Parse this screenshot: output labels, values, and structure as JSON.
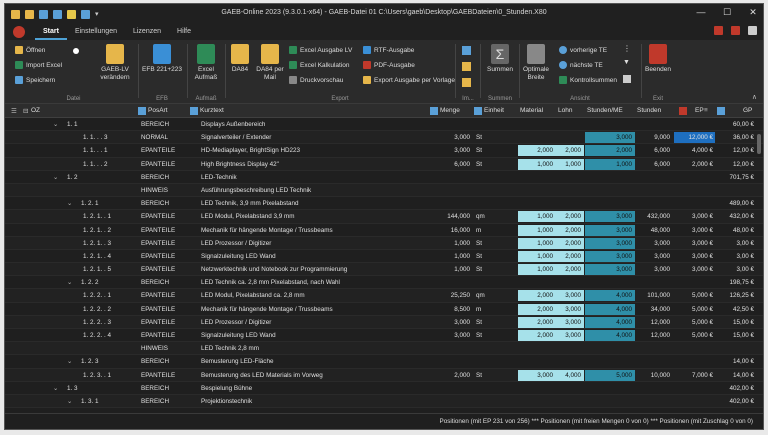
{
  "window": {
    "title": "GAEB-Online 2023 (9.3.0.1-x64) - GAEB-Datei  01 C:\\Users\\gaeb\\Desktop\\GAEBDateien\\0_Stunden.X80"
  },
  "tabs": [
    "Start",
    "Einstellungen",
    "Lizenzen",
    "Hilfe"
  ],
  "ribbon": {
    "datei": {
      "label": "Datei",
      "items": [
        "Öffnen",
        "Import Excel",
        "Speichern"
      ],
      "big": "GAEB-LV verändern"
    },
    "efb": {
      "label": "EFB",
      "big": "EFB 221+223"
    },
    "aufmass": {
      "label": "Aufmaß",
      "big": "Excel Aufmaß"
    },
    "export": {
      "label": "Export",
      "da84": "DA84",
      "da84mail": "DA84 per Mail",
      "items1": [
        "Excel Ausgabe LV",
        "Excel Kalkulation",
        "Druckvorschau"
      ],
      "items2": [
        "RTF-Ausgabe",
        "PDF-Ausgabe",
        "Export Ausgabe per Vorlage"
      ]
    },
    "im": {
      "label": "Im..."
    },
    "summen": {
      "label": "Summen",
      "big": "Summen"
    },
    "optimale": {
      "big": "Optimale Breite"
    },
    "ansicht": {
      "label": "Ansicht",
      "items": [
        "vorherige TE",
        "nächste TE",
        "Kontrollsummen"
      ]
    },
    "exit": {
      "label": "Exit",
      "big": "Beenden"
    }
  },
  "columns": {
    "oz": "OZ",
    "posart": "PosArt",
    "kurztext": "Kurztext",
    "menge": "Menge",
    "einheit": "Einheit",
    "material": "Material",
    "lohn": "Lohn",
    "stunden_me": "Stunden/ME",
    "stunden": "Stunden",
    "ep": "EP",
    "gp": "GP"
  },
  "rows": [
    {
      "oz": "1. 1",
      "lvl": 1,
      "exp": true,
      "posart": "BEREICH",
      "kurztext": "Displays Außenbereich",
      "menge": "",
      "einheit": "",
      "material": "",
      "lohn": "",
      "sme": "",
      "stunden": "",
      "ep": "",
      "gp": "60,00 €"
    },
    {
      "oz": "1. 1. . . 3",
      "lvl": 3,
      "posart": "NORMAL",
      "kurztext": "Signalverteiler / Extender",
      "menge": "3,000",
      "einheit": "St",
      "material": "",
      "lohn": "",
      "sme": "3,000",
      "stunden": "9,000",
      "ep": "12,000 €",
      "gp": "36,00 €",
      "epblue": true
    },
    {
      "oz": "1. 1. . . 1",
      "lvl": 3,
      "posart": "EPANTEILE",
      "kurztext": "HD-Mediaplayer, BrightSign HD223",
      "menge": "3,000",
      "einheit": "St",
      "material": "2,000",
      "lohn": "2,000",
      "sme": "2,000",
      "stunden": "6,000",
      "ep": "4,000 €",
      "gp": "12,00 €"
    },
    {
      "oz": "1. 1. . . 2",
      "lvl": 3,
      "posart": "EPANTEILE",
      "kurztext": "High Brightness Display 42\"",
      "menge": "6,000",
      "einheit": "St",
      "material": "1,000",
      "lohn": "1,000",
      "sme": "1,000",
      "stunden": "6,000",
      "ep": "2,000 €",
      "gp": "12,00 €"
    },
    {
      "oz": "1. 2",
      "lvl": 1,
      "exp": true,
      "posart": "BEREICH",
      "kurztext": "LED-Technik",
      "menge": "",
      "einheit": "",
      "material": "",
      "lohn": "",
      "sme": "",
      "stunden": "",
      "ep": "",
      "gp": "701,75 €"
    },
    {
      "oz": "",
      "lvl": 3,
      "posart": "HINWEIS",
      "kurztext": "Ausführungsbeschreibung LED Technik",
      "menge": "",
      "einheit": "",
      "material": "",
      "lohn": "",
      "sme": "",
      "stunden": "",
      "ep": "",
      "gp": ""
    },
    {
      "oz": "1. 2. 1",
      "lvl": 2,
      "exp": true,
      "posart": "BEREICH",
      "kurztext": "LED Technik, 3,9 mm Pixelabstand",
      "menge": "",
      "einheit": "",
      "material": "",
      "lohn": "",
      "sme": "",
      "stunden": "",
      "ep": "",
      "gp": "489,00 €"
    },
    {
      "oz": "1. 2. 1. . 1",
      "lvl": 3,
      "posart": "EPANTEILE",
      "kurztext": "LED Modul, Pixelabstand 3,9 mm",
      "menge": "144,000",
      "einheit": "qm",
      "material": "1,000",
      "lohn": "2,000",
      "sme": "3,000",
      "stunden": "432,000",
      "ep": "3,000 €",
      "gp": "432,00 €"
    },
    {
      "oz": "1. 2. 1. . 2",
      "lvl": 3,
      "posart": "EPANTEILE",
      "kurztext": "Mechanik für hängende Montage / Trussbeams",
      "menge": "16,000",
      "einheit": "m",
      "material": "1,000",
      "lohn": "2,000",
      "sme": "3,000",
      "stunden": "48,000",
      "ep": "3,000 €",
      "gp": "48,00 €"
    },
    {
      "oz": "1. 2. 1. . 3",
      "lvl": 3,
      "posart": "EPANTEILE",
      "kurztext": "LED Prozessor / Digitizer",
      "menge": "1,000",
      "einheit": "St",
      "material": "1,000",
      "lohn": "2,000",
      "sme": "3,000",
      "stunden": "3,000",
      "ep": "3,000 €",
      "gp": "3,00 €"
    },
    {
      "oz": "1. 2. 1. . 4",
      "lvl": 3,
      "posart": "EPANTEILE",
      "kurztext": "Signalzuleitung LED Wand",
      "menge": "1,000",
      "einheit": "St",
      "material": "1,000",
      "lohn": "2,000",
      "sme": "3,000",
      "stunden": "3,000",
      "ep": "3,000 €",
      "gp": "3,00 €"
    },
    {
      "oz": "1. 2. 1. . 5",
      "lvl": 3,
      "posart": "EPANTEILE",
      "kurztext": "Netzwerktechnik und Notebook zur Programmierung",
      "menge": "1,000",
      "einheit": "St",
      "material": "1,000",
      "lohn": "2,000",
      "sme": "3,000",
      "stunden": "3,000",
      "ep": "3,000 €",
      "gp": "3,00 €"
    },
    {
      "oz": "1. 2. 2",
      "lvl": 2,
      "exp": true,
      "posart": "BEREICH",
      "kurztext": "LED Technik ca. 2,8 mm Pixelabstand, nach Wahl",
      "menge": "",
      "einheit": "",
      "material": "",
      "lohn": "",
      "sme": "",
      "stunden": "",
      "ep": "",
      "gp": "198,75 €"
    },
    {
      "oz": "1. 2. 2. . 1",
      "lvl": 3,
      "posart": "EPANTEILE",
      "kurztext": "LED Modul, Pixelabstand ca. 2,8 mm",
      "menge": "25,250",
      "einheit": "qm",
      "material": "2,000",
      "lohn": "3,000",
      "sme": "4,000",
      "stunden": "101,000",
      "ep": "5,000 €",
      "gp": "126,25 €"
    },
    {
      "oz": "1. 2. 2. . 2",
      "lvl": 3,
      "posart": "EPANTEILE",
      "kurztext": "Mechanik für hängende Montage / Trussbeams",
      "menge": "8,500",
      "einheit": "m",
      "material": "2,000",
      "lohn": "3,000",
      "sme": "4,000",
      "stunden": "34,000",
      "ep": "5,000 €",
      "gp": "42,50 €"
    },
    {
      "oz": "1. 2. 2. . 3",
      "lvl": 3,
      "posart": "EPANTEILE",
      "kurztext": "LED Prozessor / Digitizer",
      "menge": "3,000",
      "einheit": "St",
      "material": "2,000",
      "lohn": "3,000",
      "sme": "4,000",
      "stunden": "12,000",
      "ep": "5,000 €",
      "gp": "15,00 €"
    },
    {
      "oz": "1. 2. 2. . 4",
      "lvl": 3,
      "posart": "EPANTEILE",
      "kurztext": "Signalzuleitung LED Wand",
      "menge": "3,000",
      "einheit": "St",
      "material": "2,000",
      "lohn": "3,000",
      "sme": "4,000",
      "stunden": "12,000",
      "ep": "5,000 €",
      "gp": "15,00 €"
    },
    {
      "oz": "",
      "lvl": 3,
      "posart": "HINWEIS",
      "kurztext": "LED Technik 2,8 mm",
      "menge": "",
      "einheit": "",
      "material": "",
      "lohn": "",
      "sme": "",
      "stunden": "",
      "ep": "",
      "gp": ""
    },
    {
      "oz": "1. 2. 3",
      "lvl": 2,
      "exp": true,
      "posart": "BEREICH",
      "kurztext": "Bemusterung LED-Fläche",
      "menge": "",
      "einheit": "",
      "material": "",
      "lohn": "",
      "sme": "",
      "stunden": "",
      "ep": "",
      "gp": "14,00 €"
    },
    {
      "oz": "1. 2. 3. . 1",
      "lvl": 3,
      "posart": "EPANTEILE",
      "kurztext": "Bemusterung des LED Materials im Vorweg",
      "menge": "2,000",
      "einheit": "St",
      "material": "3,000",
      "lohn": "4,000",
      "sme": "5,000",
      "stunden": "10,000",
      "ep": "7,000 €",
      "gp": "14,00 €"
    },
    {
      "oz": "1. 3",
      "lvl": 1,
      "exp": true,
      "posart": "BEREICH",
      "kurztext": "Bespielung Bühne",
      "menge": "",
      "einheit": "",
      "material": "",
      "lohn": "",
      "sme": "",
      "stunden": "",
      "ep": "",
      "gp": "402,00 €"
    },
    {
      "oz": "1. 3. 1",
      "lvl": 2,
      "exp": true,
      "posart": "BEREICH",
      "kurztext": "Projektionstechnik",
      "menge": "",
      "einheit": "",
      "material": "",
      "lohn": "",
      "sme": "",
      "stunden": "",
      "ep": "",
      "gp": "402,00 €"
    }
  ],
  "status": "Positionen (mit EP 231 von 256) *** Positionen (mit freien Mengen 0 von 0) *** Positionen (mit Zuschlag 0 von 0)"
}
